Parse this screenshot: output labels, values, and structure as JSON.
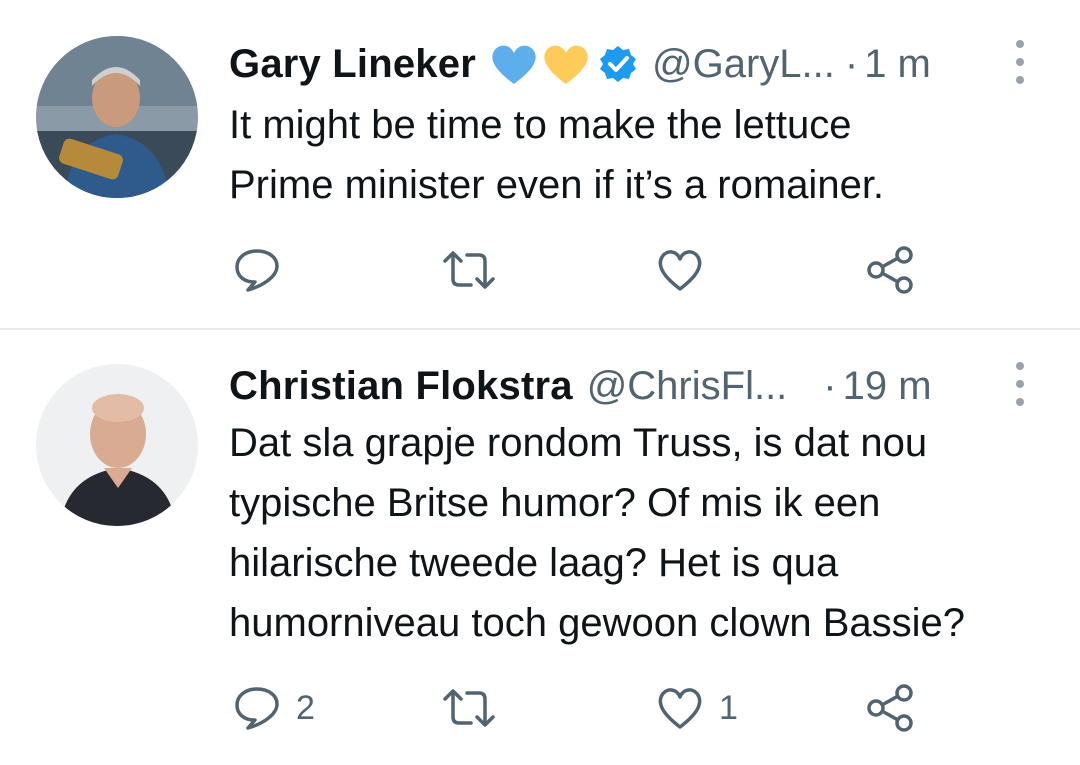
{
  "tweets": [
    {
      "author": "Gary Lineker",
      "handle": "@GaryL...",
      "dot": "·",
      "time": "1 m",
      "text_lines": [
        "It might be time to make the lettuce",
        "Prime minister even if it’s a romainer."
      ],
      "actions": {
        "reply_count": "",
        "retweet_count": "",
        "like_count": ""
      },
      "name_emojis": [
        "blue-heart",
        "yellow-heart"
      ],
      "verified": true
    },
    {
      "author": "Christian Flokstra",
      "handle": "@ChrisFl...",
      "dot": "·",
      "time": "19 m",
      "text_lines": [
        "Dat sla grapje rondom Truss, is dat nou",
        "typische Britse humor? Of mis ik een",
        "hilarische tweede laag? Het is qua",
        "humorniveau toch gewoon clown Bassie?"
      ],
      "actions": {
        "reply_count": "2",
        "retweet_count": "",
        "like_count": "1"
      },
      "verified": false
    }
  ],
  "colors": {
    "text": "#0f1419",
    "secondary": "#536471",
    "icon": "#536471",
    "verified_blue": "#1d9bf0",
    "blue_heart": "#5daeea",
    "yellow_heart": "#fdcb58",
    "divider": "#e7e7e9"
  },
  "icons": [
    "reply-icon",
    "retweet-icon",
    "like-icon",
    "share-icon",
    "more-icon",
    "verified-badge-icon"
  ]
}
